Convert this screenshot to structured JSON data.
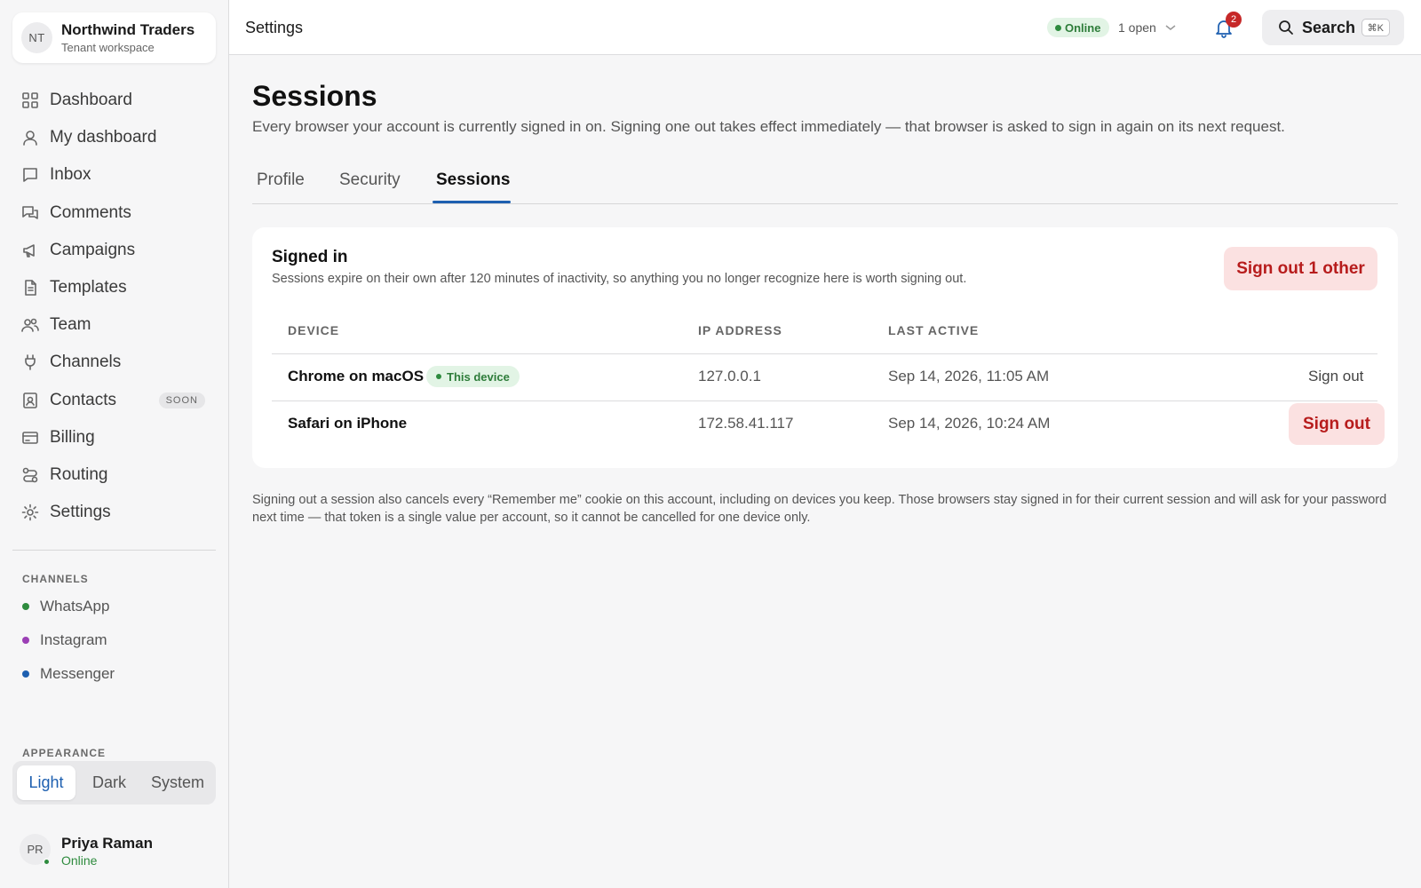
{
  "workspace": {
    "initials": "NT",
    "name": "Northwind Traders",
    "subtitle": "Tenant workspace"
  },
  "nav": [
    {
      "label": "Dashboard",
      "icon": "grid-icon"
    },
    {
      "label": "My dashboard",
      "icon": "user-icon"
    },
    {
      "label": "Inbox",
      "icon": "message-square-icon"
    },
    {
      "label": "Comments",
      "icon": "comments-icon"
    },
    {
      "label": "Campaigns",
      "icon": "megaphone-icon"
    },
    {
      "label": "Templates",
      "icon": "document-icon"
    },
    {
      "label": "Team",
      "icon": "users-icon"
    },
    {
      "label": "Channels",
      "icon": "plug-icon"
    },
    {
      "label": "Contacts",
      "icon": "contact-card-icon",
      "badge": "SOON"
    },
    {
      "label": "Billing",
      "icon": "credit-card-icon"
    },
    {
      "label": "Routing",
      "icon": "route-icon"
    },
    {
      "label": "Settings",
      "icon": "gear-icon"
    }
  ],
  "channels_section": {
    "label": "CHANNELS",
    "items": [
      {
        "label": "WhatsApp",
        "color": "#2e8b3e"
      },
      {
        "label": "Instagram",
        "color": "#9b3fb5"
      },
      {
        "label": "Messenger",
        "color": "#1d5fb0"
      }
    ]
  },
  "appearance": {
    "label": "APPEARANCE",
    "options": [
      "Light",
      "Dark",
      "System"
    ],
    "selected": "Light"
  },
  "user": {
    "initials": "PR",
    "name": "Priya Raman",
    "status": "Online"
  },
  "topbar": {
    "breadcrumb": "Settings",
    "status": "Online",
    "open_count": "1 open",
    "notifications": "2",
    "search_label": "Search",
    "search_shortcut": "⌘K"
  },
  "page": {
    "title": "Sessions",
    "description": "Every browser your account is currently signed in on. Signing one out takes effect immediately — that browser is asked to sign in again on its next request.",
    "tabs": [
      "Profile",
      "Security",
      "Sessions"
    ],
    "active_tab": "Sessions"
  },
  "card": {
    "title": "Signed in",
    "subtitle": "Sessions expire on their own after 120 minutes of inactivity, so anything you no longer recognize here is worth signing out.",
    "sign_out_others": "Sign out 1 other",
    "columns": [
      "DEVICE",
      "IP ADDRESS",
      "LAST ACTIVE"
    ],
    "rows": [
      {
        "device": "Chrome on macOS",
        "badge": "This device",
        "ip": "127.0.0.1",
        "last_active": "Sep 14, 2026, 11:05 AM",
        "action": "Sign out"
      },
      {
        "device": "Safari on iPhone",
        "ip": "172.58.41.117",
        "last_active": "Sep 14, 2026, 10:24 AM",
        "action": "Sign out"
      }
    ]
  },
  "footnote": "Signing out a session also cancels every “Remember me” cookie on this account, including on devices you keep. Those browsers stay signed in for their current session and will ask for your password next time — that token is a single value per account, so it cannot be cancelled for one device only.",
  "colors": {
    "accent": "#1d5fb0",
    "danger": "#b71c1c",
    "danger_bg": "#fbe1e1",
    "success": "#2e8b3e"
  }
}
